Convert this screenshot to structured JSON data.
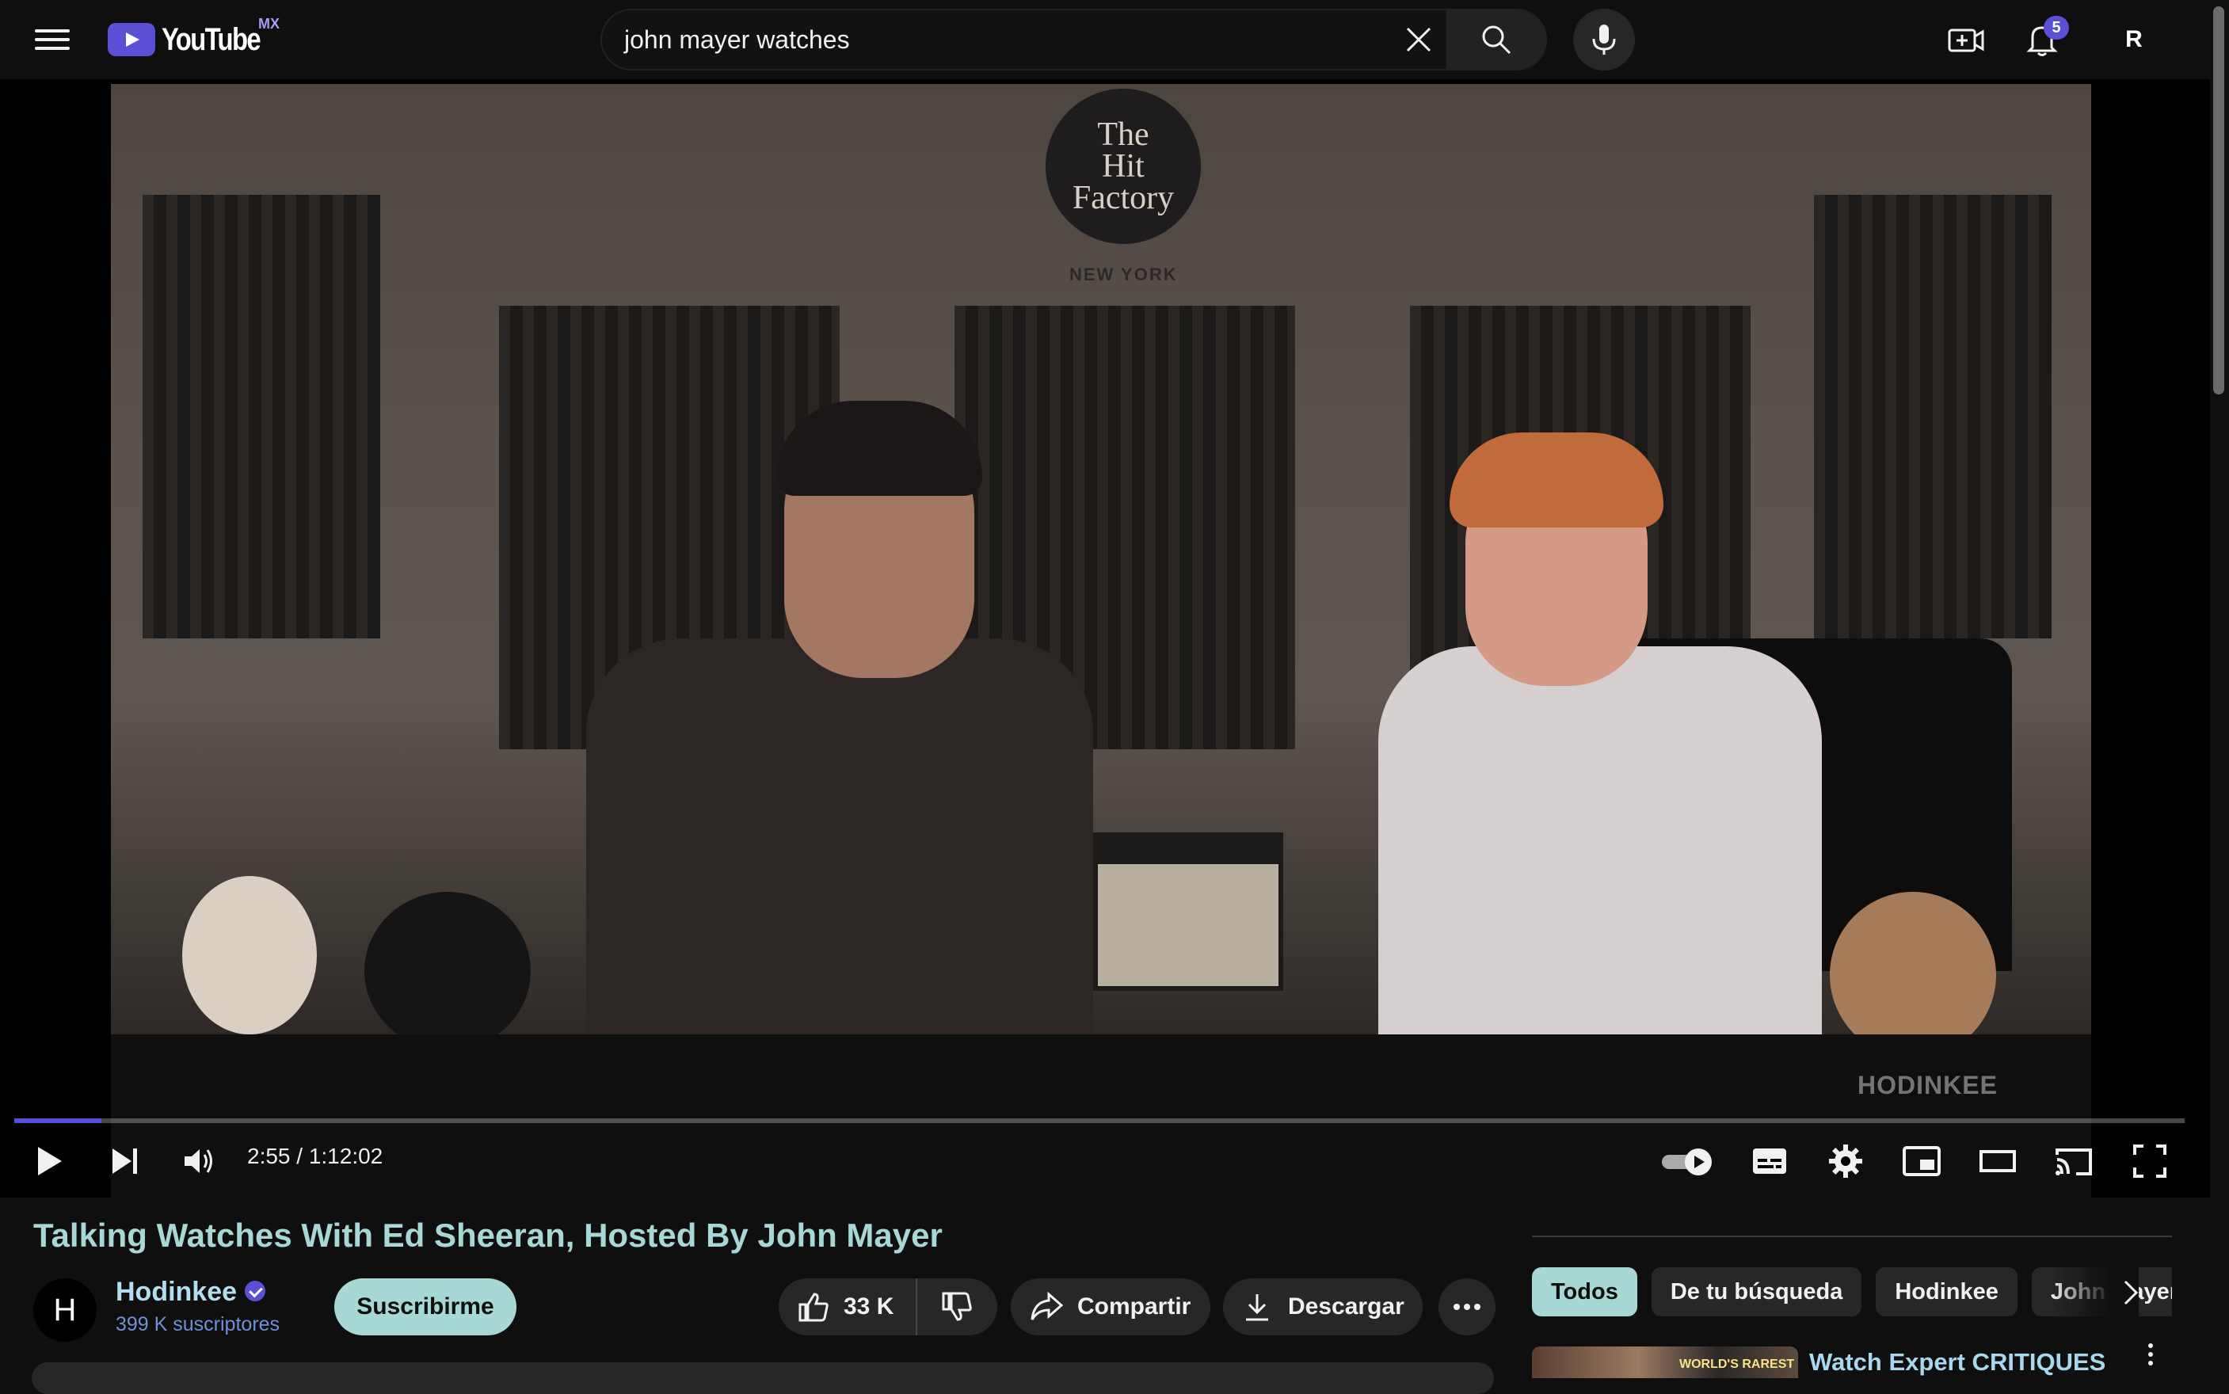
{
  "header": {
    "logo_text": "YouTube",
    "region": "MX",
    "search_query": "john mayer watches",
    "notifications_count": "5",
    "avatar_initial": "R"
  },
  "icons": {
    "menu": "hamburger-icon",
    "search": "search-icon",
    "clear": "close-icon",
    "mic": "microphone-icon",
    "create": "create-video-icon",
    "notifications": "bell-icon"
  },
  "player": {
    "current_time": "2:55 / 1:12:02",
    "progress_fraction": 0.04,
    "watermark": "HODINKEE",
    "scene": {
      "sign_line1": "The",
      "sign_line2": "Hit",
      "sign_line3": "Factory",
      "sign_sub": "NEW YORK"
    }
  },
  "video": {
    "title": "Talking Watches With Ed Sheeran, Hosted By John Mayer"
  },
  "channel": {
    "avatar_letter": "H",
    "name": "Hodinkee",
    "subscribers": "399 K suscriptores",
    "subscribe_label": "Suscribirme"
  },
  "actions": {
    "likes": "33 K",
    "share_label": "Compartir",
    "download_label": "Descargar"
  },
  "sidebar": {
    "chips": [
      "Todos",
      "De tu búsqueda",
      "Hodinkee",
      "John Mayer"
    ],
    "active_chip": "Todos",
    "recommendation": {
      "title": "Watch Expert CRITIQUES",
      "thumb_text": "WORLD'S RAREST"
    }
  },
  "colors": {
    "accent": "#5b4fd6",
    "title_tint": "#a7d8d5",
    "background": "#0f0f0f"
  }
}
